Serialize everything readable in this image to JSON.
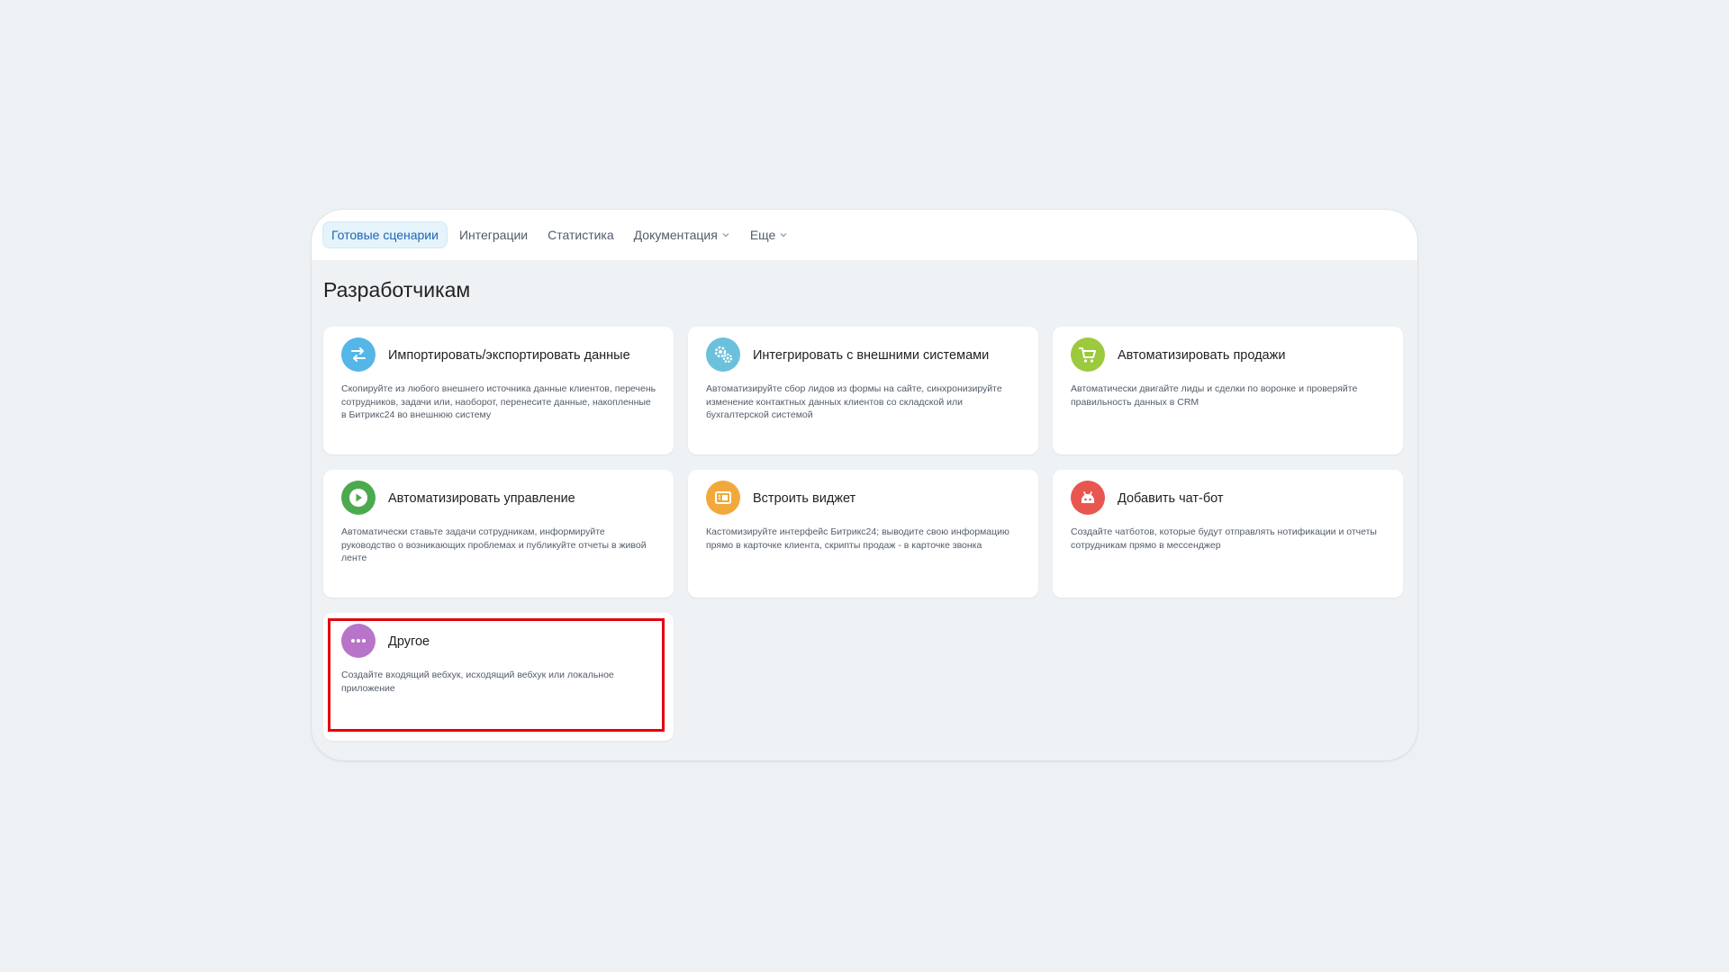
{
  "tabs": [
    {
      "label": "Готовые сценарии",
      "active": true
    },
    {
      "label": "Интеграции"
    },
    {
      "label": "Статистика"
    },
    {
      "label": "Документация",
      "dropdown": true
    },
    {
      "label": "Еще",
      "dropdown": true
    }
  ],
  "page_title": "Разработчикам",
  "cards": [
    {
      "title": "Импортировать/экспортировать данные",
      "description": "Скопируйте из любого внешнего источника данные клиентов, перечень сотрудников, задачи или, наоборот, перенесите данные, накопленные в Битрикс24 во внешнюю систему",
      "icon": "transfer-arrows-icon",
      "color": "#55b6e8"
    },
    {
      "title": "Интегрировать с внешними системами",
      "description": "Автоматизируйте сбор лидов из формы на сайте, синхронизируйте изменение контактных данных клиентов со складской или бухгалтерской системой",
      "icon": "gears-icon",
      "color": "#6bc1dc"
    },
    {
      "title": "Автоматизировать продажи",
      "description": "Автоматически двигайте лиды и сделки по воронке и проверяйте правильность данных в CRM",
      "icon": "cart-icon",
      "color": "#9cc93d"
    },
    {
      "title": "Автоматизировать управление",
      "description": "Автоматически ставьте задачи сотрудникам, информируйте руководство о возникающих проблемах и публикуйте отчеты в живой ленте",
      "icon": "play-icon",
      "color": "#4caa4e"
    },
    {
      "title": "Встроить виджет",
      "description": "Кастомизируйте интерфейс Битрикс24; выводите свою информацию прямо в карточке клиента, скрипты продаж - в карточке звонка",
      "icon": "widget-icon",
      "color": "#f2a93b"
    },
    {
      "title": "Добавить чат-бот",
      "description": "Создайте чатботов, которые будут отправлять нотификации и отчеты сотрудникам прямо в мессенджер",
      "icon": "robot-icon",
      "color": "#e8574f"
    },
    {
      "title": "Другое",
      "description": "Создайте входящий вебхук, исходящий вебхук или локальное приложение",
      "icon": "more-dots-icon",
      "color": "#b774c9",
      "highlighted": true
    }
  ]
}
